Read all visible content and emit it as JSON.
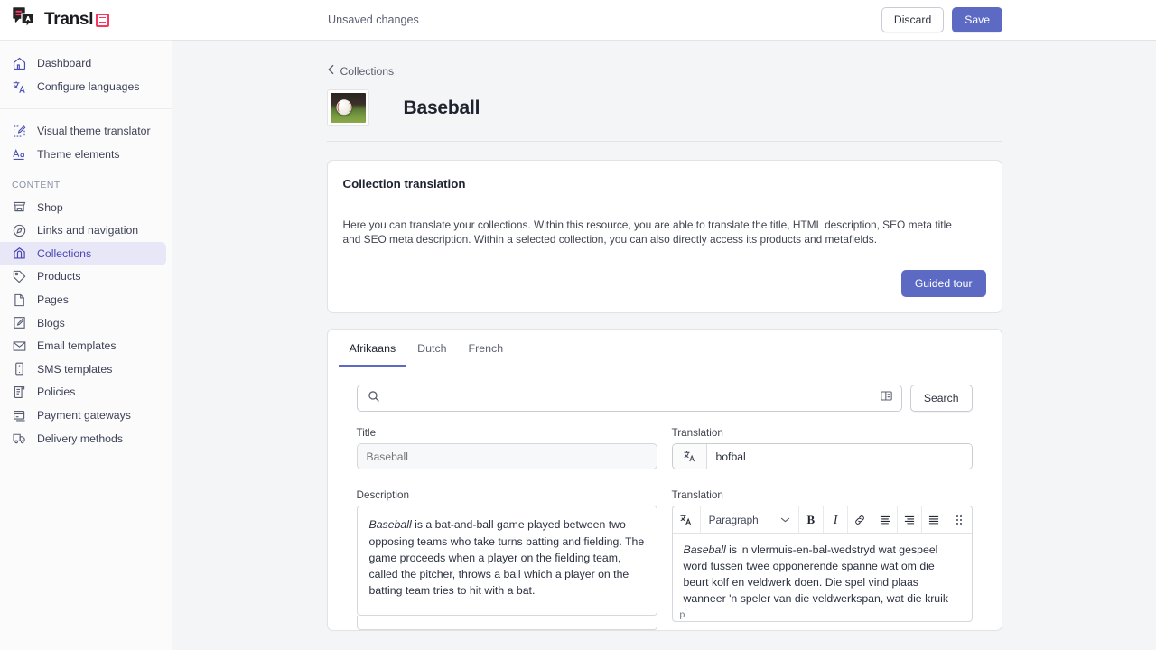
{
  "brand": {
    "name": "Transl",
    "mark_icon": "translate-bubbles-icon",
    "badge_icon": "transl-square-icon"
  },
  "sidebar": {
    "groups": [
      {
        "items": [
          {
            "label": "Dashboard",
            "icon": "home-icon"
          },
          {
            "label": "Configure languages",
            "icon": "translate-icon"
          }
        ]
      },
      {
        "items": [
          {
            "label": "Visual theme translator",
            "icon": "edit-theme-icon"
          },
          {
            "label": "Theme elements",
            "icon": "typography-icon"
          }
        ]
      }
    ],
    "section_title": "CONTENT",
    "content_items": [
      {
        "label": "Shop",
        "icon": "store-icon",
        "active": false
      },
      {
        "label": "Links and navigation",
        "icon": "compass-icon",
        "active": false
      },
      {
        "label": "Collections",
        "icon": "collection-icon",
        "active": true
      },
      {
        "label": "Products",
        "icon": "tag-icon",
        "active": false
      },
      {
        "label": "Pages",
        "icon": "page-icon",
        "active": false
      },
      {
        "label": "Blogs",
        "icon": "blog-pencil-icon",
        "active": false
      },
      {
        "label": "Email templates",
        "icon": "envelope-icon",
        "active": false
      },
      {
        "label": "SMS templates",
        "icon": "phone-icon",
        "active": false
      },
      {
        "label": "Policies",
        "icon": "policy-scroll-icon",
        "active": false
      },
      {
        "label": "Payment gateways",
        "icon": "payment-card-icon",
        "active": false
      },
      {
        "label": "Delivery methods",
        "icon": "truck-icon",
        "active": false
      }
    ]
  },
  "topbar": {
    "status_text": "Unsaved changes",
    "discard_label": "Discard",
    "save_label": "Save"
  },
  "breadcrumb": {
    "label": "Collections",
    "icon": "chevron-left-icon"
  },
  "page": {
    "title": "Baseball",
    "thumbnail_icon": "baseball-thumbnail"
  },
  "intro_card": {
    "heading": "Collection translation",
    "body": "Here you can translate your collections. Within this resource, you are able to translate the title, HTML description, SEO meta title and SEO meta description. Within a selected collection, you can also directly access its products and metafields.",
    "tour_label": "Guided tour"
  },
  "tabs": [
    {
      "label": "Afrikaans",
      "active": true
    },
    {
      "label": "Dutch",
      "active": false
    },
    {
      "label": "French",
      "active": false
    }
  ],
  "search": {
    "value": "",
    "placeholder": "",
    "filter_icon": "filter-layout-icon",
    "search_icon": "search-icon",
    "button_label": "Search"
  },
  "title_field": {
    "label": "Title",
    "source_placeholder": "Baseball",
    "source_value": "",
    "translation_label": "Translation",
    "translation_value": "bofbal",
    "translate_icon": "translate-icon"
  },
  "description_field": {
    "label": "Description",
    "translation_label": "Translation",
    "source_lead_italic": "Baseball",
    "source_text": " is a bat-and-ball game played between two opposing teams who take turns batting and fielding. The game proceeds when a player on the fielding team, called the pitcher, throws a ball which a player on the batting team tries to hit with a bat.",
    "translation_lead_italic": "Baseball",
    "translation_text": " is 'n vlermuis-en-bal-wedstryd wat gespeel word tussen twee opponerende spanne wat om die beurt kolf en veldwerk doen. Die spel vind plaas wanneer 'n speler van die veldwerkspan, wat die kruik genoem word, 'n bal gooi wat 'n speler in die kolfspan",
    "status_label": "p"
  },
  "editor_toolbar": {
    "translate_icon": "translate-icon",
    "block_format": "Paragraph",
    "chevron_icon": "chevron-down-icon",
    "bold_label": "B",
    "italic_label": "I",
    "link_icon": "link-icon",
    "align_left_icon": "align-left-icon",
    "align_right_icon": "align-right-icon",
    "align_justify_icon": "align-justify-icon",
    "more_icon": "drag-dots-icon"
  },
  "colors": {
    "accent": "#5c6ac4",
    "sidebar_active_bg": "#e8e7f8",
    "brand_pink": "#f8365f"
  }
}
